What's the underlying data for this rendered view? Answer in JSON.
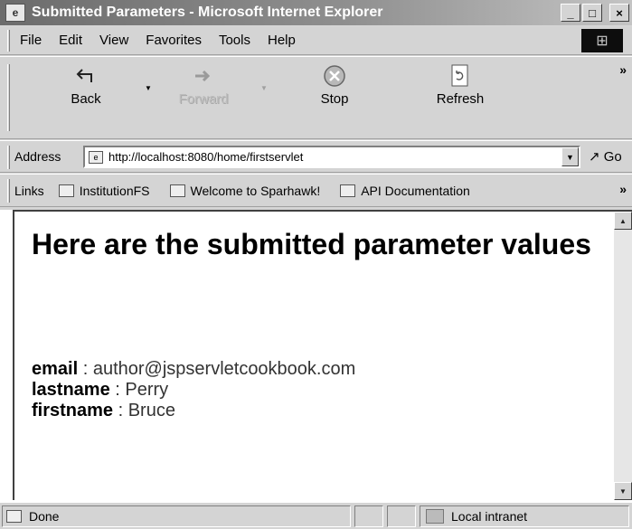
{
  "window": {
    "title": "Submitted Parameters - Microsoft Internet Explorer",
    "controls": {
      "minimize": "_",
      "maximize": "□",
      "close": "×"
    }
  },
  "menu": [
    "File",
    "Edit",
    "View",
    "Favorites",
    "Tools",
    "Help"
  ],
  "toolbar": {
    "back": "Back",
    "forward": "Forward",
    "stop": "Stop",
    "refresh": "Refresh",
    "more": "»"
  },
  "address": {
    "label": "Address",
    "url": "http://localhost:8080/home/firstservlet",
    "go": "Go"
  },
  "links": {
    "label": "Links",
    "items": [
      "InstitutionFS",
      "Welcome to Sparhawk!",
      "API Documentation"
    ],
    "more": "»"
  },
  "content": {
    "heading": "Here are the submitted parameter values",
    "params": [
      {
        "name": "email",
        "value": "author@jspservletcookbook.com"
      },
      {
        "name": "lastname",
        "value": "Perry"
      },
      {
        "name": "firstname",
        "value": "Bruce"
      }
    ],
    "separator": " : "
  },
  "status": {
    "text": "Done",
    "zone": "Local intranet"
  }
}
